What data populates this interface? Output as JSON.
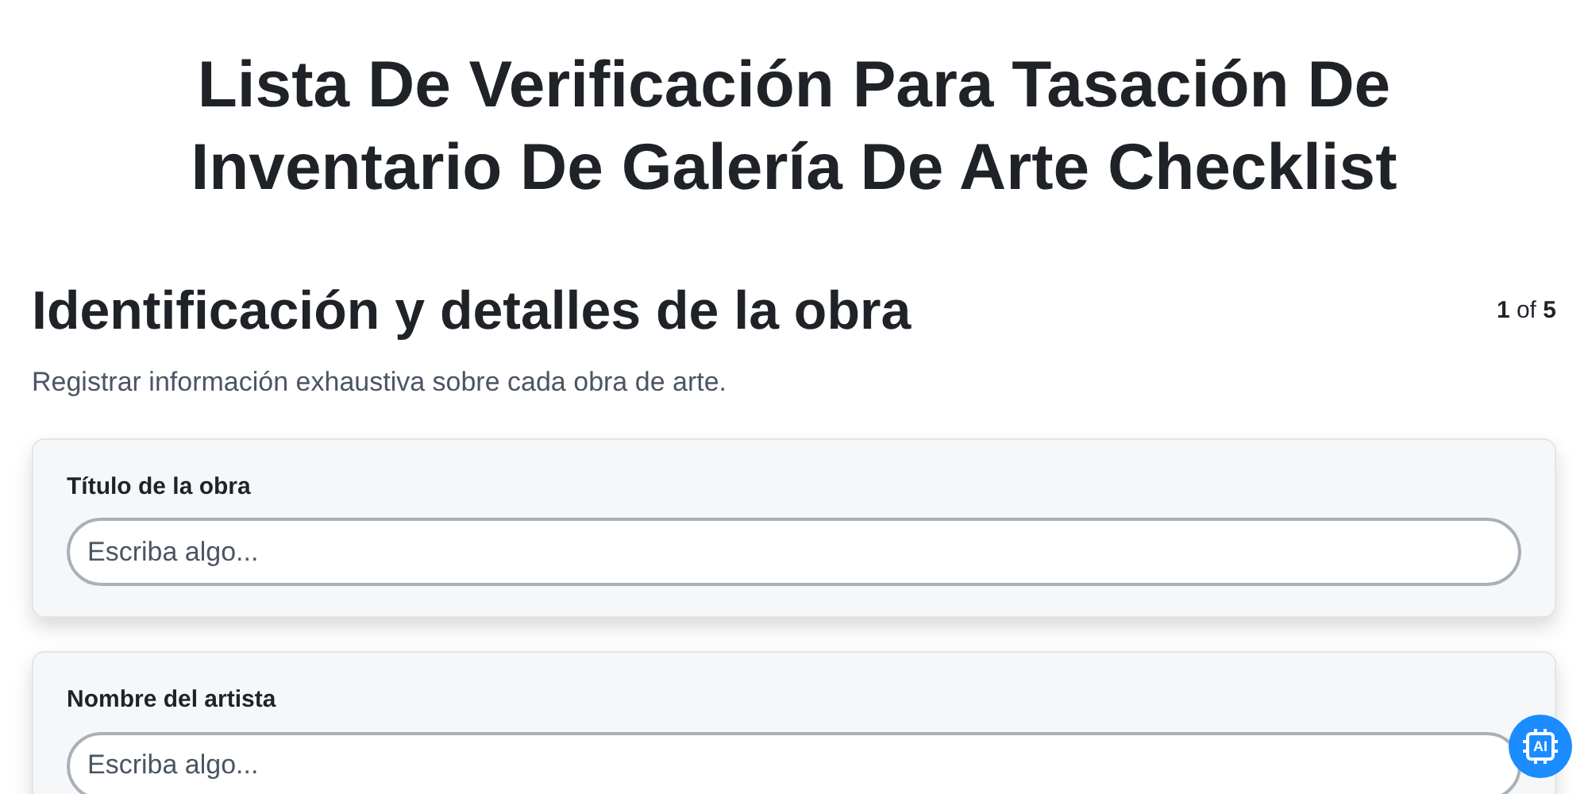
{
  "title": "Lista De Verificación Para Tasación De Inventario De Galería De Arte Checklist",
  "section": {
    "heading": "Identificación y detalles de la obra",
    "pager": {
      "current": "1",
      "separator": "of",
      "total": "5"
    },
    "description": "Registrar información exhaustiva sobre cada obra de arte."
  },
  "fields": [
    {
      "label": "Título de la obra",
      "placeholder": "Escriba algo..."
    },
    {
      "label": "Nombre del artista",
      "placeholder": "Escriba algo..."
    }
  ],
  "assistant_badge": {
    "text": "AI"
  }
}
